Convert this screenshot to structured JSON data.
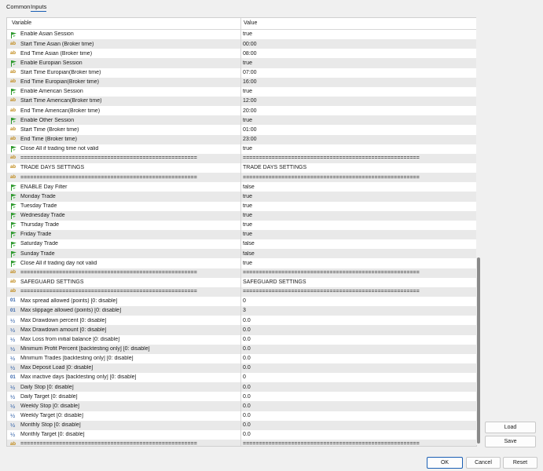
{
  "tabs": [
    {
      "label": "Common"
    },
    {
      "label": "Inputs"
    }
  ],
  "table": {
    "header_variable": "Variable",
    "header_value": "Value",
    "rows": [
      {
        "icon": "flag",
        "name": "Enable Asian Session",
        "value": "true"
      },
      {
        "icon": "ab",
        "name": "Start Time Asian (Broker time)",
        "value": "00:00"
      },
      {
        "icon": "ab",
        "name": "End Time Asian (Broker time)",
        "value": "08:00"
      },
      {
        "icon": "flag",
        "name": "Enable Europian Session",
        "value": "true"
      },
      {
        "icon": "ab",
        "name": "Start Time Europian(Broker time)",
        "value": "07:00"
      },
      {
        "icon": "ab",
        "name": "End Time Europian(Broker time)",
        "value": "16:00"
      },
      {
        "icon": "flag",
        "name": "Enable American Session",
        "value": "true"
      },
      {
        "icon": "ab",
        "name": "Start Time American(Broker time)",
        "value": "12:00"
      },
      {
        "icon": "ab",
        "name": "End Time American(Broker time)",
        "value": "20:00"
      },
      {
        "icon": "flag",
        "name": "Enable Other Session",
        "value": "true"
      },
      {
        "icon": "ab",
        "name": "Start Time (Broker time)",
        "value": "01:00"
      },
      {
        "icon": "ab",
        "name": "End Time (Broker time)",
        "value": "23:00"
      },
      {
        "icon": "flag",
        "name": "Close All if trading time not valid",
        "value": "true"
      },
      {
        "icon": "ab",
        "name": "=======================================================",
        "value": "======================================================="
      },
      {
        "icon": "ab",
        "name": "TRADE DAYS SETTINGS",
        "value": "TRADE DAYS SETTINGS"
      },
      {
        "icon": "ab",
        "name": "=======================================================",
        "value": "======================================================="
      },
      {
        "icon": "flag",
        "name": "ENABLE Day Filter",
        "value": "false"
      },
      {
        "icon": "flag",
        "name": "Monday Trade",
        "value": "true"
      },
      {
        "icon": "flag",
        "name": "Tuesday Trade",
        "value": "true"
      },
      {
        "icon": "flag",
        "name": "Wednesday Trade",
        "value": "true"
      },
      {
        "icon": "flag",
        "name": "Thursday Trade",
        "value": "true"
      },
      {
        "icon": "flag",
        "name": "Friday Trade",
        "value": "true"
      },
      {
        "icon": "flag",
        "name": "Saturday Trade",
        "value": "false"
      },
      {
        "icon": "flag",
        "name": "Sunday Trade",
        "value": "false"
      },
      {
        "icon": "flag",
        "name": "Close All if trading day not valid",
        "value": "true"
      },
      {
        "icon": "ab",
        "name": "=======================================================",
        "value": "======================================================="
      },
      {
        "icon": "ab",
        "name": "SAFEGUARD SETTINGS",
        "value": "SAFEGUARD SETTINGS"
      },
      {
        "icon": "ab",
        "name": "=======================================================",
        "value": "======================================================="
      },
      {
        "icon": "num",
        "name": "Max spread allowed (points) [0: disable]",
        "value": "0"
      },
      {
        "icon": "num",
        "name": "Max slippage allowed (points) [0: disable]",
        "value": "3"
      },
      {
        "icon": "frac",
        "name": "Max Drawdown percent [0: disable]",
        "value": "0.0"
      },
      {
        "icon": "frac",
        "name": "Max Drawdown amount [0: disable]",
        "value": "0.0"
      },
      {
        "icon": "frac",
        "name": "Max Loss from initial balance [0: disable]",
        "value": "0.0"
      },
      {
        "icon": "frac",
        "name": "Minimum Profit Percent [backtesting only] [0: disable]",
        "value": "0.0"
      },
      {
        "icon": "frac",
        "name": "Minimum Trades [backtesting only] [0: disable]",
        "value": "0.0"
      },
      {
        "icon": "frac",
        "name": "Max Deposit Load [0: disable]",
        "value": "0.0"
      },
      {
        "icon": "num",
        "name": "Max inactive days [backtesting only] [0: disable]",
        "value": "0"
      },
      {
        "icon": "frac",
        "name": "Daily Stop [0: disable]",
        "value": "0.0"
      },
      {
        "icon": "frac",
        "name": "Daily Target [0: disable]",
        "value": "0.0"
      },
      {
        "icon": "frac",
        "name": "Weekly Stop [0: disable]",
        "value": "0.0"
      },
      {
        "icon": "frac",
        "name": "Weekly Target [0: disable]",
        "value": "0.0"
      },
      {
        "icon": "frac",
        "name": "Monthly Stop [0: disable]",
        "value": "0.0"
      },
      {
        "icon": "frac",
        "name": "Monthly Target [0: disable]",
        "value": "0.0"
      },
      {
        "icon": "ab",
        "name": "=======================================================",
        "value": "======================================================="
      }
    ]
  },
  "side_buttons": {
    "load": "Load",
    "save": "Save"
  },
  "footer_buttons": {
    "ok": "OK",
    "cancel": "Cancel",
    "reset": "Reset"
  },
  "colors": {
    "accent": "#1a5fb4",
    "flag": "#2e9a2e",
    "ab": "#c08a1a",
    "numeric": "#2f5fa8"
  }
}
